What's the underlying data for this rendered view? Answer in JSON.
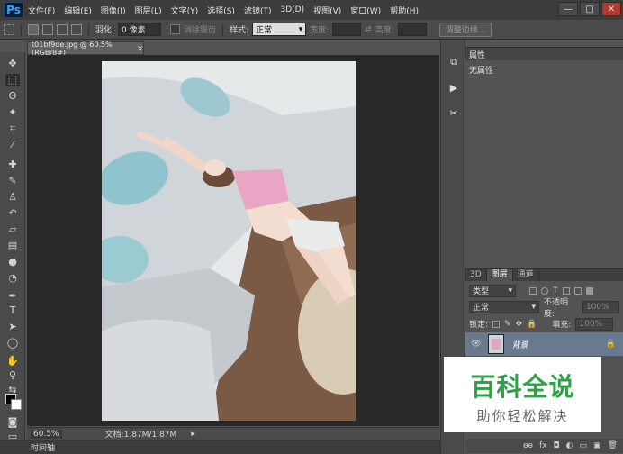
{
  "app": {
    "logo": "Ps"
  },
  "menu": [
    "文件(F)",
    "编辑(E)",
    "图像(I)",
    "图层(L)",
    "文字(Y)",
    "选择(S)",
    "滤镜(T)",
    "3D(D)",
    "视图(V)",
    "窗口(W)",
    "帮助(H)"
  ],
  "window_controls": {
    "minimize": "—",
    "maximize": "□",
    "close": "✕"
  },
  "options": {
    "feather_label": "羽化:",
    "feather_value": "0 像素",
    "antialias_label": "消除锯齿",
    "style_label": "样式:",
    "style_value": "正常",
    "width_label": "宽度:",
    "height_label": "高度:",
    "refine_edge": "调整边缘..."
  },
  "document": {
    "tab_title": "t01bf9de.jpg @ 60.5%(RGB/8#)",
    "tab_close": "×"
  },
  "status": {
    "zoom": "60.5%",
    "doc_info": "文档:1.87M/1.87M"
  },
  "timeline_label": "时间轴",
  "properties": {
    "tab": "属性",
    "body": "无属性"
  },
  "layers_panel": {
    "tabs": [
      "3D",
      "图层",
      "通道"
    ],
    "filter_kind": "类型",
    "blend_mode": "正常",
    "opacity_label": "不透明度:",
    "opacity_value": "100%",
    "lock_label": "锁定:",
    "fill_label": "填充:",
    "fill_value": "100%",
    "layer_name": "背景",
    "footer_icons": [
      "ɵɵ",
      "fx",
      "◘",
      "◐",
      "▭",
      "▣",
      "🗑"
    ]
  },
  "watermark": {
    "main": "百科全说",
    "sub": "助你轻松解决"
  },
  "colors": {
    "accent_ps": "#31a8ff",
    "watermark_green": "#2fa146",
    "selected_layer": "#6a7a8e"
  }
}
